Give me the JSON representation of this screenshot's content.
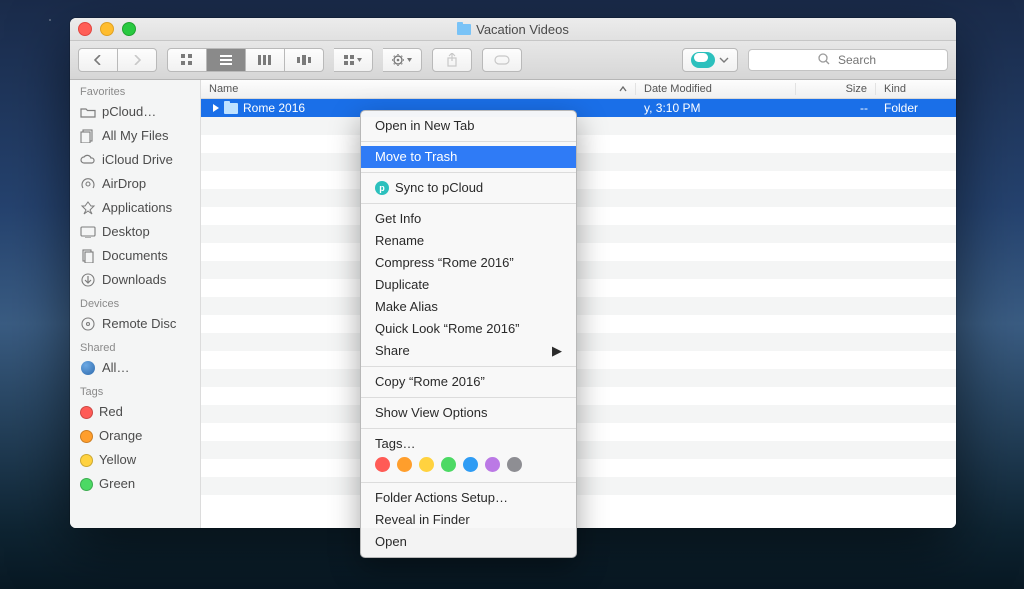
{
  "window": {
    "title": "Vacation Videos"
  },
  "search": {
    "placeholder": "Search"
  },
  "columns": {
    "name": "Name",
    "date": "Date Modified",
    "size": "Size",
    "kind": "Kind"
  },
  "row": {
    "name": "Rome 2016",
    "date": "y, 3:10 PM",
    "size": "--",
    "kind": "Folder"
  },
  "sidebar": {
    "favorites_head": "Favorites",
    "favorites": [
      {
        "label": "pCloud…",
        "icon": "folder"
      },
      {
        "label": "All My Files",
        "icon": "allfiles"
      },
      {
        "label": "iCloud Drive",
        "icon": "cloud"
      },
      {
        "label": "AirDrop",
        "icon": "airdrop"
      },
      {
        "label": "Applications",
        "icon": "apps"
      },
      {
        "label": "Desktop",
        "icon": "desktop"
      },
      {
        "label": "Documents",
        "icon": "docs"
      },
      {
        "label": "Downloads",
        "icon": "downloads"
      }
    ],
    "devices_head": "Devices",
    "devices": [
      {
        "label": "Remote Disc",
        "icon": "disc"
      }
    ],
    "shared_head": "Shared",
    "shared": [
      {
        "label": "All…",
        "icon": "globe"
      }
    ],
    "tags_head": "Tags",
    "tags": [
      {
        "label": "Red",
        "color": "#ff5b56"
      },
      {
        "label": "Orange",
        "color": "#ff9e2c"
      },
      {
        "label": "Yellow",
        "color": "#ffd23f"
      },
      {
        "label": "Green",
        "color": "#4cd964"
      }
    ]
  },
  "ctx": {
    "open_tab": "Open in New Tab",
    "trash": "Move to Trash",
    "sync": "Sync to pCloud",
    "getinfo": "Get Info",
    "rename": "Rename",
    "compress": "Compress “Rome 2016”",
    "duplicate": "Duplicate",
    "alias": "Make Alias",
    "quicklook": "Quick Look “Rome 2016”",
    "share": "Share",
    "copy": "Copy “Rome 2016”",
    "viewopts": "Show View Options",
    "tags": "Tags…",
    "tag_colors": [
      "#ff5b56",
      "#ff9e2c",
      "#ffd23f",
      "#4cd964",
      "#2f9cf4",
      "#bb79e5",
      "#8e8e93"
    ],
    "fas": "Folder Actions Setup…",
    "reveal": "Reveal in Finder",
    "open": "Open"
  }
}
